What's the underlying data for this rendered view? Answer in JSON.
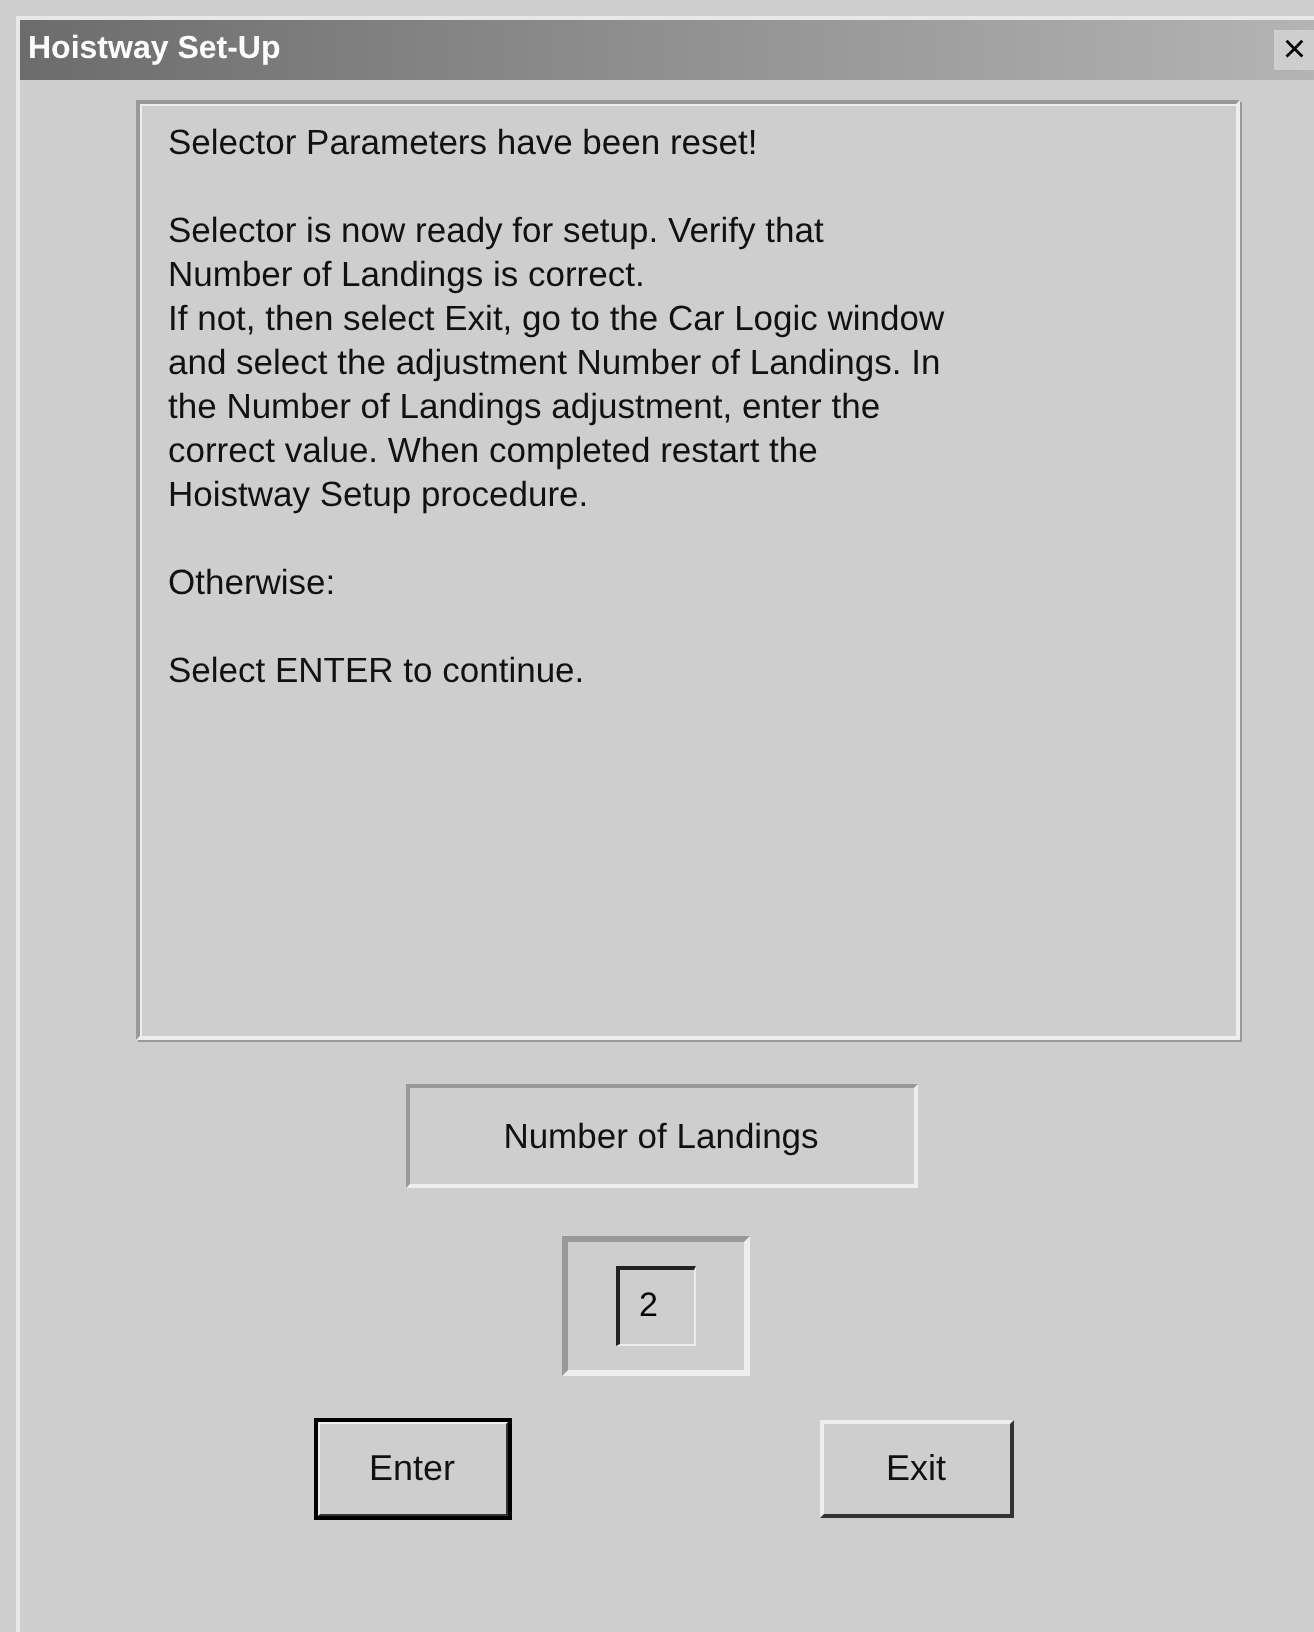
{
  "window": {
    "title": "Hoistway Set-Up",
    "close": "×"
  },
  "message": {
    "paragraphs": [
      [
        "Selector Parameters have been reset!"
      ],
      [
        "Selector is now ready for setup.  Verify that",
        "Number of Landings is correct.",
        "If not, then select Exit, go to the Car Logic window",
        "and select the adjustment Number of Landings.  In",
        "the Number of Landings adjustment, enter the",
        "correct value.  When completed restart the",
        "Hoistway Setup procedure."
      ],
      [
        "Otherwise:"
      ],
      [
        "Select ENTER to continue."
      ]
    ]
  },
  "parameter": {
    "label": "Number of Landings",
    "value": "2"
  },
  "buttons": [
    {
      "label": "Enter",
      "default": true
    },
    {
      "label": "Exit",
      "default": false
    }
  ]
}
